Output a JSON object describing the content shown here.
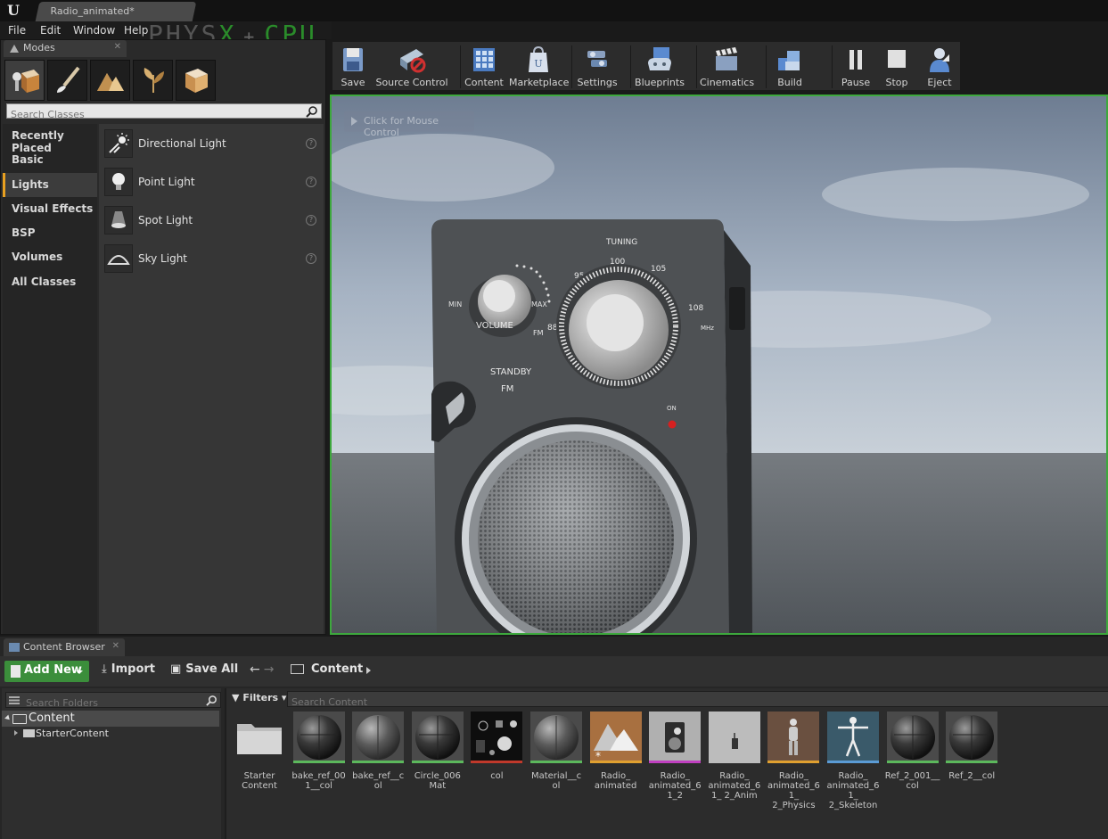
{
  "window": {
    "doc_tab": "Radio_animated*",
    "overlay_physx": "PHYS",
    "overlay_x": "X",
    "overlay_plus": "+",
    "overlay_cpu": "CPU"
  },
  "menu": [
    "File",
    "Edit",
    "Window",
    "Help"
  ],
  "modes": {
    "tab_label": "Modes",
    "search_placeholder": "Search Classes",
    "categories": [
      "Recently Placed",
      "Basic",
      "Lights",
      "Visual Effects",
      "BSP",
      "Volumes",
      "All Classes"
    ],
    "active_category": "Lights",
    "classes": [
      "Directional Light",
      "Point Light",
      "Spot Light",
      "Sky Light"
    ]
  },
  "toolbar": {
    "buttons": [
      "Save",
      "Source Control",
      "Content",
      "Marketplace",
      "Settings",
      "Blueprints",
      "Cinematics",
      "Build",
      "Pause",
      "Stop",
      "Eject"
    ]
  },
  "viewport": {
    "mouse_control": "Click for Mouse Control",
    "radio_labels": {
      "tuning": "TUNING",
      "t95": "95",
      "t100": "100",
      "t105": "105",
      "t108": "108",
      "t88": "88",
      "mhz": "MHz",
      "fm": "FM",
      "volume": "VOLUME",
      "min": "MIN",
      "max": "MAX",
      "standby": "STANDBY",
      "fm2": "FM",
      "on": "ON"
    }
  },
  "content_browser": {
    "tab_label": "Content Browser",
    "add_new": "Add New",
    "import": "Import",
    "save_all": "Save All",
    "breadcrumb": "Content",
    "folder_search_placeholder": "Search Folders",
    "root_folder": "Content",
    "child_folder": "StarterContent",
    "filters": "Filters",
    "asset_search_placeholder": "Search Content",
    "assets": [
      {
        "name": "Starter Content",
        "kind": "folder",
        "bar": ""
      },
      {
        "name": "bake_ref_001__col",
        "kind": "sphere-dark",
        "bar": "#5cb85c"
      },
      {
        "name": "bake_ref__col",
        "kind": "sphere-mid",
        "bar": "#5cb85c"
      },
      {
        "name": "Circle_006 Mat",
        "kind": "sphere-dark",
        "bar": "#5cb85c"
      },
      {
        "name": "col",
        "kind": "texture",
        "bar": "#c0392b"
      },
      {
        "name": "Material__col",
        "kind": "sphere-mid",
        "bar": "#5cb85c"
      },
      {
        "name": "Radio_ animated",
        "kind": "level",
        "bar": "#e0a030"
      },
      {
        "name": "Radio_ animated_61_2",
        "kind": "radio",
        "bar": "#c040c0"
      },
      {
        "name": "Radio_ animated_61_ 2_Anim",
        "kind": "anim",
        "bar": ""
      },
      {
        "name": "Radio_ animated_61_ 2_Physics",
        "kind": "physics",
        "bar": "#e0a030"
      },
      {
        "name": "Radio_ animated_61_ 2_Skeleton",
        "kind": "skeleton",
        "bar": "#5b9bd5"
      },
      {
        "name": "Ref_2_001__col",
        "kind": "sphere-dark",
        "bar": "#5cb85c"
      },
      {
        "name": "Ref_2__col",
        "kind": "sphere-dark",
        "bar": "#5cb85c"
      }
    ]
  }
}
